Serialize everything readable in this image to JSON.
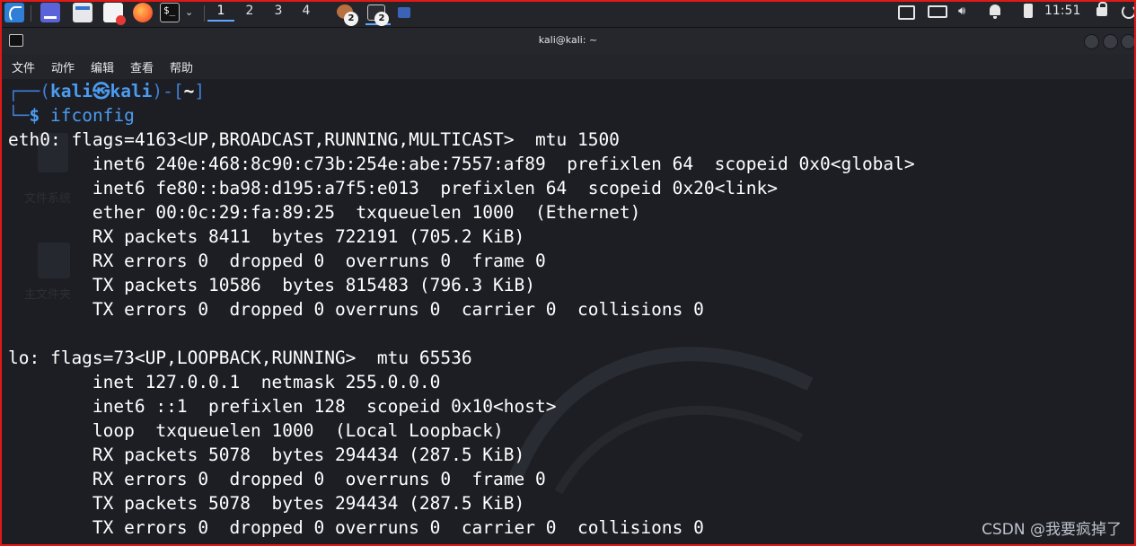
{
  "taskbar": {
    "workspaces": [
      "1",
      "2",
      "3",
      "4"
    ],
    "active_workspace": "1",
    "task_badges": [
      "2",
      "2"
    ],
    "clock": "11:51"
  },
  "window": {
    "title": "kali@kali: ~",
    "menu": [
      "文件",
      "动作",
      "编辑",
      "查看",
      "帮助"
    ]
  },
  "terminal": {
    "prompt_user": "kali",
    "prompt_symbol": "㉿",
    "prompt_host": "kali",
    "prompt_dir": "~",
    "prompt_dollar": "$",
    "command": "ifconfig",
    "output": [
      "eth0: flags=4163<UP,BROADCAST,RUNNING,MULTICAST>  mtu 1500",
      "        inet6 240e:468:8c90:c73b:254e:abe:7557:af89  prefixlen 64  scopeid 0x0<global>",
      "        inet6 fe80::ba98:d195:a7f5:e013  prefixlen 64  scopeid 0x20<link>",
      "        ether 00:0c:29:fa:89:25  txqueuelen 1000  (Ethernet)",
      "        RX packets 8411  bytes 722191 (705.2 KiB)",
      "        RX errors 0  dropped 0  overruns 0  frame 0",
      "        TX packets 10586  bytes 815483 (796.3 KiB)",
      "        TX errors 0  dropped 0 overruns 0  carrier 0  collisions 0",
      "",
      "lo: flags=73<UP,LOOPBACK,RUNNING>  mtu 65536",
      "        inet 127.0.0.1  netmask 255.0.0.0",
      "        inet6 ::1  prefixlen 128  scopeid 0x10<host>",
      "        loop  txqueuelen 1000  (Local Loopback)",
      "        RX packets 5078  bytes 294434 (287.5 KiB)",
      "        RX errors 0  dropped 0  overruns 0  frame 0",
      "        TX packets 5078  bytes 294434 (287.5 KiB)",
      "        TX errors 0  dropped 0 overruns 0  carrier 0  collisions 0"
    ]
  },
  "desktop_watermarks": [
    "文件系统",
    "主文件夹"
  ],
  "watermark": "CSDN @我要疯掉了",
  "colors": {
    "frame_border": "#e01818",
    "prompt_blue": "#4b9cf0",
    "terminal_bg": "#1c1e24",
    "active_tab_underline": "#5fa8ff"
  },
  "icons": [
    "kali-menu-icon",
    "workspace-manager-icon",
    "file-manager-icon",
    "text-editor-icon",
    "firefox-icon",
    "terminal-icon",
    "monitor-icon",
    "keyboard-icon",
    "volume-icon",
    "bell-icon",
    "battery-icon",
    "lock-icon",
    "power-icon"
  ]
}
